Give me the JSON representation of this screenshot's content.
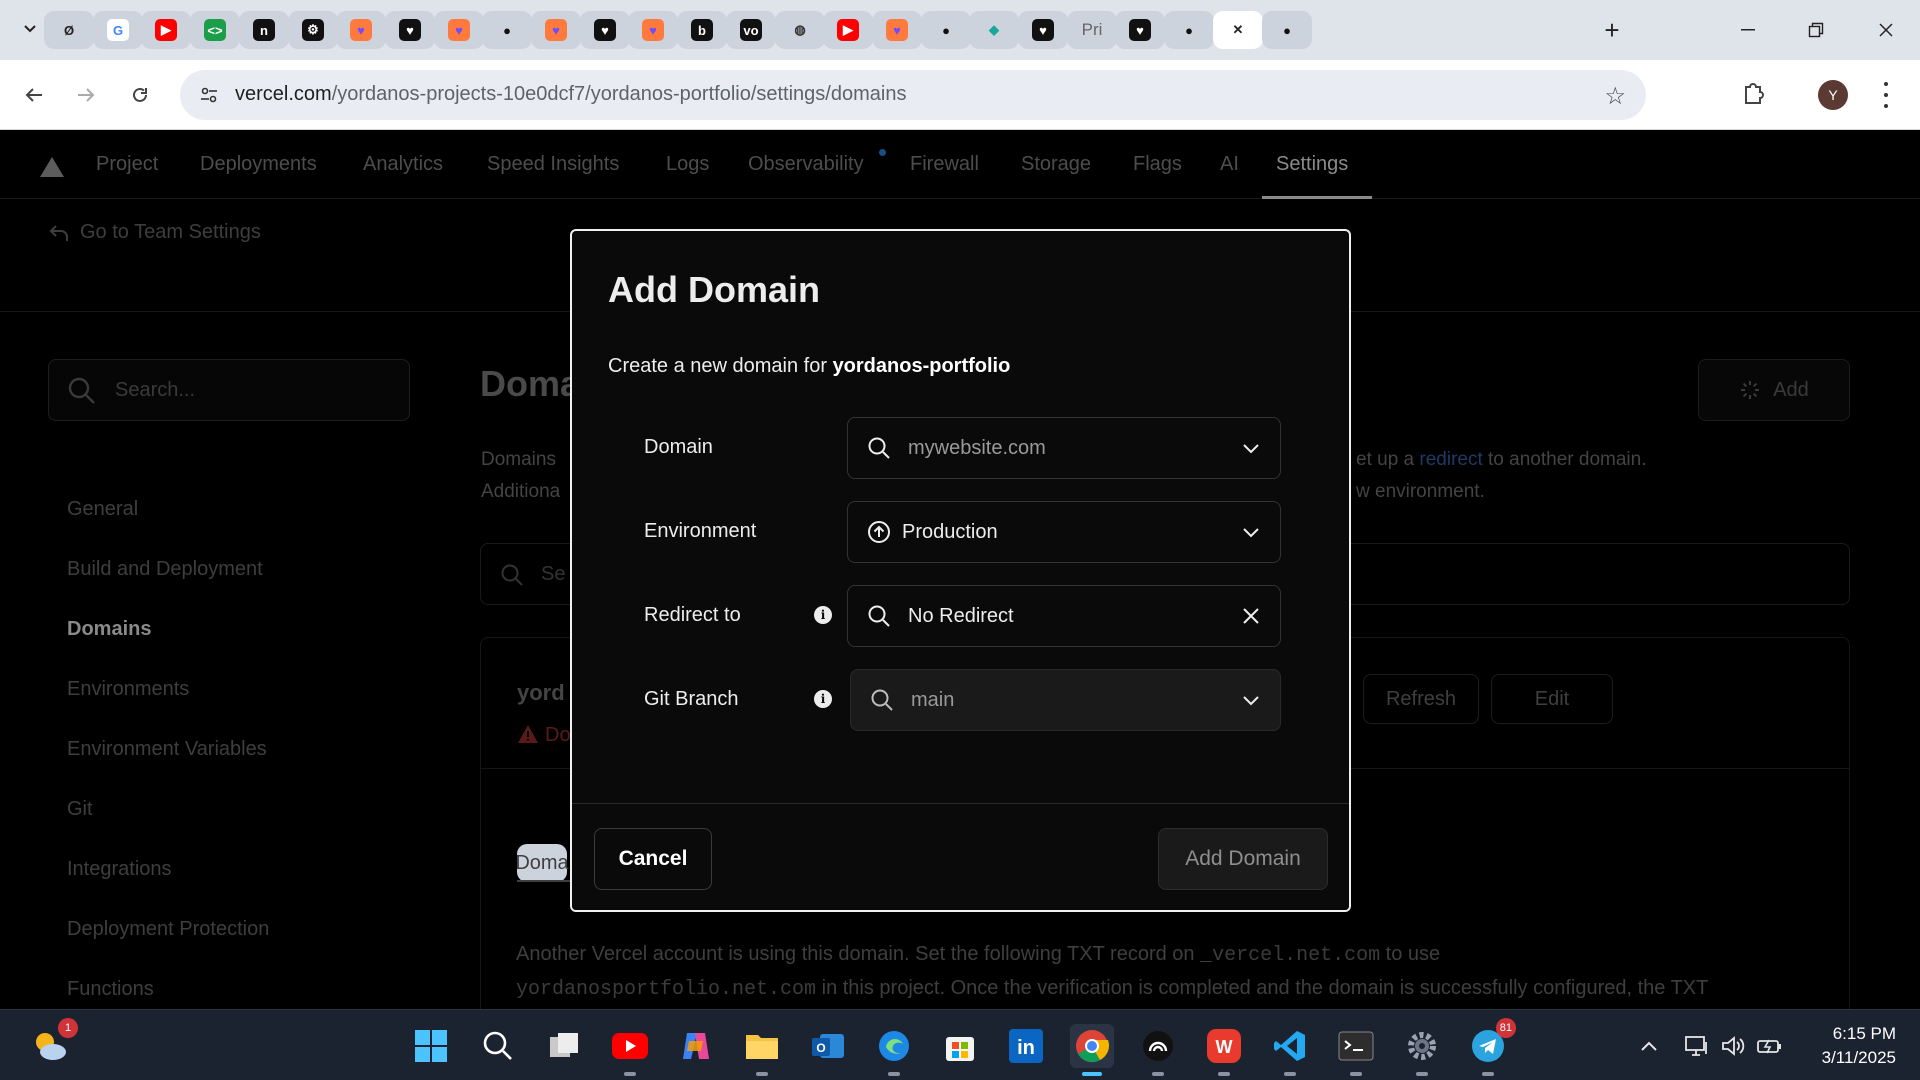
{
  "browser": {
    "tabs": [
      {
        "icon": "slash-app-icon",
        "glyph": "Ø",
        "bg": "#cdd3dd",
        "fg": "#222"
      },
      {
        "icon": "google-icon",
        "glyph": "G",
        "bg": "#ffffff",
        "fg": "#4285f4"
      },
      {
        "icon": "youtube-icon",
        "glyph": "▶",
        "bg": "#ff0000",
        "fg": "#ffffff"
      },
      {
        "icon": "code-icon",
        "glyph": "<>",
        "bg": "#1b9e4a",
        "fg": "#ffffff"
      },
      {
        "icon": "notion-icon",
        "glyph": "n",
        "bg": "#111111",
        "fg": "#ffffff"
      },
      {
        "icon": "openai-icon",
        "glyph": "⚙",
        "bg": "#111111",
        "fg": "#ffffff"
      },
      {
        "icon": "heart-icon",
        "glyph": "♥",
        "bg": "#ff7a3c",
        "fg": "#6e4cff"
      },
      {
        "icon": "pocket-icon",
        "glyph": "♥",
        "bg": "#111111",
        "fg": "#ffffff"
      },
      {
        "icon": "heart-icon",
        "glyph": "♥",
        "bg": "#ff7a3c",
        "fg": "#6e4cff"
      },
      {
        "icon": "github-icon",
        "glyph": "●",
        "bg": "#cdd3dd",
        "fg": "#111"
      },
      {
        "icon": "heart-icon",
        "glyph": "♥",
        "bg": "#ff7a3c",
        "fg": "#6e4cff"
      },
      {
        "icon": "pocket-icon",
        "glyph": "♥",
        "bg": "#111111",
        "fg": "#ffffff"
      },
      {
        "icon": "heart-icon",
        "glyph": "♥",
        "bg": "#ff7a3c",
        "fg": "#6e4cff"
      },
      {
        "icon": "b-app-icon",
        "glyph": "b",
        "bg": "#111111",
        "fg": "#ffffff"
      },
      {
        "icon": "vo-app-icon",
        "glyph": "vo",
        "bg": "#111111",
        "fg": "#ffffff"
      },
      {
        "icon": "globe-icon",
        "glyph": "◍",
        "bg": "#cdd3dd",
        "fg": "#333"
      },
      {
        "icon": "youtube-icon",
        "glyph": "▶",
        "bg": "#ff0000",
        "fg": "#ffffff"
      },
      {
        "icon": "heart-icon",
        "glyph": "♥",
        "bg": "#ff7a3c",
        "fg": "#6e4cff"
      },
      {
        "icon": "github-icon",
        "glyph": "●",
        "bg": "#cdd3dd",
        "fg": "#111"
      },
      {
        "icon": "diamond-icon",
        "glyph": "◆",
        "bg": "#cdd3dd",
        "fg": "#16a99a"
      },
      {
        "icon": "pocket-icon",
        "glyph": "♥",
        "bg": "#111111",
        "fg": "#ffffff"
      },
      {
        "icon": "text-tab-icon",
        "text": "Pri"
      },
      {
        "icon": "pocket-icon",
        "glyph": "♥",
        "bg": "#111111",
        "fg": "#ffffff"
      },
      {
        "icon": "github-icon",
        "glyph": "●",
        "bg": "#cdd3dd",
        "fg": "#111"
      },
      {
        "icon": "close-icon",
        "glyph": "✕",
        "bg": "#ffffff",
        "fg": "#222",
        "active": true
      },
      {
        "icon": "github-icon",
        "glyph": "●",
        "bg": "#cdd3dd",
        "fg": "#111"
      }
    ],
    "url_host": "vercel.com",
    "url_path": "/yordanos-projects-10e0dcf7/yordanos-portfolio/settings/domains",
    "avatar_letter": "Y"
  },
  "vercel": {
    "nav": [
      "Project",
      "Deployments",
      "Analytics",
      "Speed Insights",
      "Logs",
      "Observability",
      "Firewall",
      "Storage",
      "Flags",
      "AI",
      "Settings"
    ],
    "back_link": "Go to Team Settings",
    "sidebar_search_placeholder": "Search...",
    "sidebar": [
      "General",
      "Build and Deployment",
      "Domains",
      "Environments",
      "Environment Variables",
      "Git",
      "Integrations",
      "Deployment Protection",
      "Functions"
    ],
    "page_title_partial": "Doma",
    "desc_line1_left": "Domains",
    "desc_line1_right_a": "et up a ",
    "desc_line1_link": "redirect",
    "desc_line1_right_b": " to another domain.",
    "desc_line2_left": "Additiona",
    "desc_line2_right": "w environment.",
    "add_button": "Add",
    "search_partial": "Se",
    "card_name_partial": "yord",
    "card_warn_partial": "Do",
    "refresh_button": "Refresh",
    "edit_button": "Edit",
    "card_tab_partial": "Doma",
    "info_line1_a": "Another Vercel account is using this domain. Set the following TXT record on ",
    "info_line1_code": "_vercel.net.com",
    "info_line1_b": " to use",
    "info_line2_code": "yordanosportfolio.net.com",
    "info_line2_b": " in this project. Once the verification is completed and the domain is successfully configured, the TXT"
  },
  "modal": {
    "title": "Add Domain",
    "subtitle_prefix": "Create a new domain for ",
    "subtitle_project": "yordanos-portfolio",
    "fields": {
      "domain": {
        "label": "Domain",
        "placeholder": "mywebsite.com"
      },
      "environment": {
        "label": "Environment",
        "value": "Production"
      },
      "redirect": {
        "label": "Redirect to",
        "value": "No Redirect"
      },
      "git_branch": {
        "label": "Git Branch",
        "placeholder": "main"
      }
    },
    "cancel": "Cancel",
    "submit": "Add Domain"
  },
  "taskbar": {
    "weather_badge": "1",
    "telegram_badge": "81",
    "time": "6:15 PM",
    "date": "3/11/2025"
  }
}
